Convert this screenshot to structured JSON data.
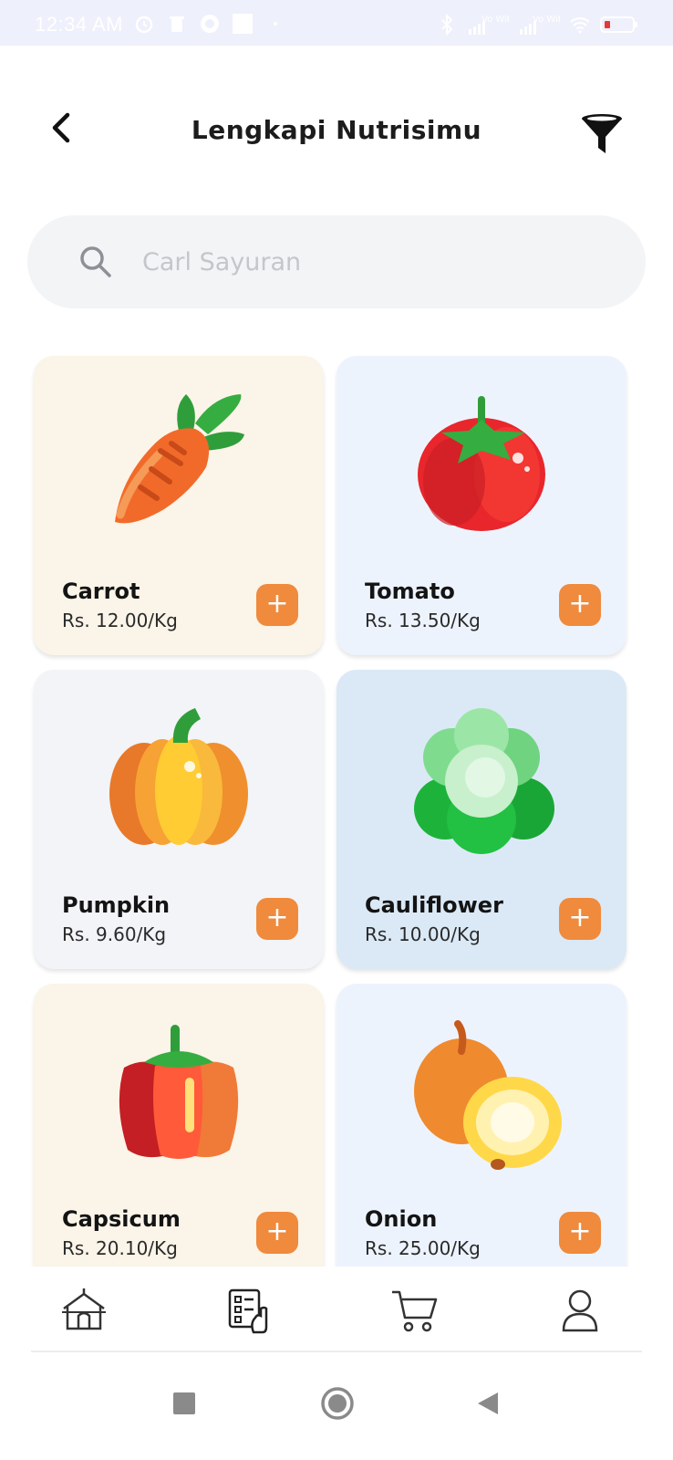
{
  "status_bar": {
    "time": "12:34 AM",
    "icons_left": [
      "alarm-icon",
      "trash-icon",
      "viber-icon",
      "square-icon",
      "dot-icon"
    ],
    "icons_right": [
      "bluetooth-icon",
      "vowifi-signal-icon",
      "vowifi-signal-icon",
      "wifi-icon",
      "battery-icon"
    ],
    "network_label_1": "Vo WiFi",
    "network_label_2": "Vo WiFi"
  },
  "header": {
    "title": "Lengkapi Nutrisimu",
    "back_icon": "chevron-left-icon",
    "filter_icon": "funnel-icon"
  },
  "search": {
    "placeholder": "Carl Sayuran",
    "value": "",
    "icon": "search-icon"
  },
  "colors": {
    "accent": "#f08a3c",
    "card_cream": "#fbf4e8",
    "card_blue": "#edf3fd",
    "card_gray": "#f2f4f7",
    "card_teal": "#dbe9f6",
    "search_bg": "#f3f4f6",
    "status_bar_bg": "#eef0fb"
  },
  "products": [
    {
      "name": "Carrot",
      "price": "Rs. 12.00/Kg",
      "icon": "carrot-icon",
      "bg": "#fbf4e8"
    },
    {
      "name": "Tomato",
      "price": "Rs. 13.50/Kg",
      "icon": "tomato-icon",
      "bg": "#edf3fd"
    },
    {
      "name": "Pumpkin",
      "price": "Rs. 9.60/Kg",
      "icon": "pumpkin-icon",
      "bg": "#f2f4f7"
    },
    {
      "name": "Cauliflower",
      "price": "Rs. 10.00/Kg",
      "icon": "cauliflower-icon",
      "bg": "#dbe9f6"
    },
    {
      "name": "Capsicum",
      "price": "Rs. 20.10/Kg",
      "icon": "capsicum-icon",
      "bg": "#fbf4e8"
    },
    {
      "name": "Onion",
      "price": "Rs. 25.00/Kg",
      "icon": "onion-icon",
      "bg": "#edf3fd"
    }
  ],
  "add_label": "+",
  "bottom_nav": {
    "items": [
      "home-icon",
      "order-list-icon",
      "cart-icon",
      "profile-icon"
    ]
  },
  "system_nav": {
    "items": [
      "recents-icon",
      "home-circle-icon",
      "back-triangle-icon"
    ]
  }
}
